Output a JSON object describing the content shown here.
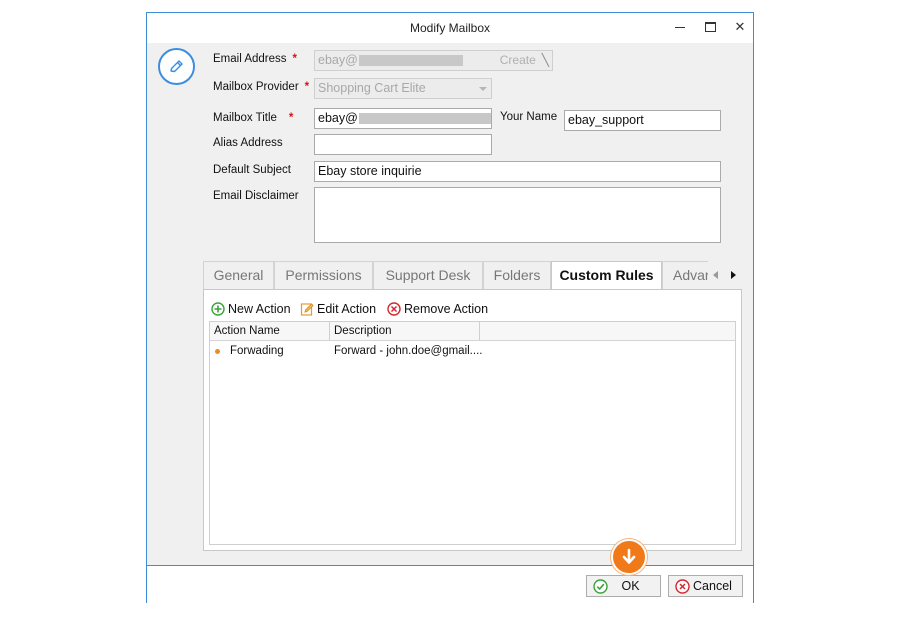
{
  "window": {
    "title": "Modify Mailbox",
    "accent": "#3c8fd6"
  },
  "form": {
    "email_address": {
      "label": "Email Address",
      "value_prefix": "ebay@",
      "action": "Create"
    },
    "mailbox_provider": {
      "label": "Mailbox Provider",
      "value": "Shopping Cart Elite"
    },
    "mailbox_title": {
      "label": "Mailbox Title",
      "value_prefix": "ebay@"
    },
    "your_name": {
      "label": "Your Name",
      "value": "ebay_support"
    },
    "alias_address": {
      "label": "Alias Address",
      "value": ""
    },
    "default_subject": {
      "label": "Default Subject",
      "value": "Ebay store inquirie"
    },
    "email_disclaimer": {
      "label": "Email Disclaimer",
      "value": ""
    },
    "required_mark": "*"
  },
  "tabs": [
    {
      "label": "General"
    },
    {
      "label": "Permissions"
    },
    {
      "label": "Support Desk"
    },
    {
      "label": "Folders"
    },
    {
      "label": "Custom Rules",
      "active": true
    },
    {
      "label": "Advar"
    }
  ],
  "toolbar": {
    "new_action": "New Action",
    "edit_action": "Edit Action",
    "remove_action": "Remove Action"
  },
  "grid": {
    "columns": [
      "Action Name",
      "Description"
    ],
    "rows": [
      {
        "name": "Forwading",
        "description": "Forward - john.doe@gmail...."
      }
    ]
  },
  "footer": {
    "ok_label": "OK",
    "cancel_label": "Cancel"
  },
  "icons": {
    "edit": "pencil-icon",
    "new": "plus-circle-icon",
    "remove": "x-circle-icon",
    "ok": "check-circle-icon",
    "pointer": "arrow-down-icon"
  }
}
